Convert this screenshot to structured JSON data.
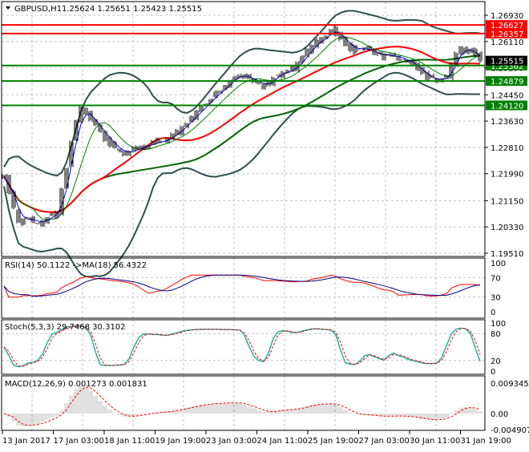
{
  "header": {
    "symbol": "GBPUSD,H1",
    "ohlc": "1.25624 1.25651 1.25423 1.25515"
  },
  "main_axis": {
    "ticks": [
      "1.26930",
      "1.26110",
      "1.25290",
      "1.24450",
      "1.23630",
      "1.22810",
      "1.21990",
      "1.21150",
      "1.20330",
      "1.19510"
    ],
    "range": [
      1.1951,
      1.2693
    ]
  },
  "levels": [
    {
      "value": 1.26627,
      "label": "1.26627",
      "color": "#ff0000"
    },
    {
      "value": 1.26357,
      "label": "1.26357",
      "color": "#ff0000"
    },
    {
      "value": 1.25362,
      "label": "1.25362",
      "color": "#008000"
    },
    {
      "value": 1.24879,
      "label": "1.24879",
      "color": "#008000"
    },
    {
      "value": 1.2412,
      "label": "1.24120",
      "color": "#008000"
    }
  ],
  "current_price": {
    "value": 1.25515,
    "label": "1.25515"
  },
  "rsi": {
    "title": "RSI(14) 50.1122  ->MA(18) 56.4322",
    "ticks": [
      "100",
      "70",
      "30",
      "0"
    ]
  },
  "stoch": {
    "title": "Stoch(5,3,3) 29.7468 30.3102",
    "ticks": [
      "100",
      "80",
      "20",
      "0"
    ]
  },
  "macd": {
    "title": "MACD(12,26,9) 0.001273 0.001831",
    "ticks": [
      "0.009345",
      "0.00",
      "-0.004907"
    ]
  },
  "time_axis": [
    "13 Jan 2017",
    "17 Jan 03:00",
    "18 Jan 11:00",
    "19 Jan 19:00",
    "23 Jan 03:00",
    "24 Jan 11:00",
    "25 Jan 19:00",
    "27 Jan 03:00",
    "30 Jan 11:00",
    "31 Jan 19:00"
  ],
  "colors": {
    "fast_ma": "#0000ff",
    "mid_ma": "#008000",
    "slow_ma": "#ff0000",
    "long_ma": "#006400",
    "bands": "#2f4f4f",
    "rsi": "#ff0000",
    "rsi_ma": "#000080",
    "stoch_main": "#20b2aa",
    "stoch_signal": "#ff0000",
    "macd_hist": "#c0c0c0",
    "macd_signal": "#ff0000"
  },
  "chart_data": {
    "type": "line",
    "series": [
      {
        "values": [
          1.219,
          1.214,
          1.209,
          1.205,
          1.206,
          1.206,
          1.205,
          1.2045,
          1.205,
          1.2065,
          1.207,
          1.208,
          1.215,
          1.222,
          1.23,
          1.236,
          1.24,
          1.2385,
          1.237,
          1.235,
          1.233,
          1.231,
          1.2295,
          1.228,
          1.227,
          1.226,
          1.227,
          1.2275,
          1.228,
          1.2285,
          1.229,
          1.2295,
          1.23,
          1.23,
          1.231,
          1.232,
          1.233,
          1.2345,
          1.236,
          1.2375,
          1.239,
          1.2405,
          1.242,
          1.2435,
          1.245,
          1.246,
          1.2475,
          1.249,
          1.25,
          1.251,
          1.25,
          1.2495,
          1.249,
          1.248,
          1.247,
          1.2485,
          1.25,
          1.251,
          1.2515,
          1.252,
          1.2525,
          1.2545,
          1.256,
          1.258,
          1.26,
          1.261,
          1.262,
          1.263,
          1.265,
          1.264,
          1.262,
          1.2605,
          1.259,
          1.2585,
          1.259,
          1.259,
          1.258,
          1.2575,
          1.257,
          1.2565,
          1.257,
          1.2565,
          1.256,
          1.2555,
          1.2545,
          1.254,
          1.2525,
          1.251,
          1.25,
          1.2495,
          1.249,
          1.2495,
          1.25,
          1.254,
          1.257,
          1.259,
          1.2585,
          1.258,
          1.257,
          1.25515
        ]
      }
    ],
    "ylim": [
      1.1951,
      1.2693
    ],
    "grid": true
  }
}
